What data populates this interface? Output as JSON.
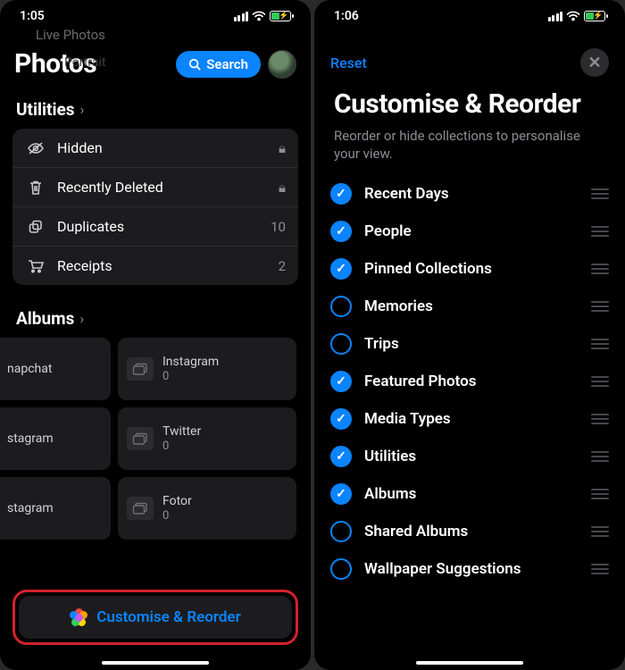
{
  "left": {
    "status": {
      "time": "1:05"
    },
    "ghost_bg_1": "Live Photos",
    "ghost_bg_2": "Portrait",
    "app_title": "Photos",
    "search_label": "Search",
    "sections": {
      "utilities": {
        "title": "Utilities",
        "rows": [
          {
            "label": "Hidden",
            "meta_icon": "lock"
          },
          {
            "label": "Recently Deleted",
            "meta_icon": "lock"
          },
          {
            "label": "Duplicates",
            "meta": "10"
          },
          {
            "label": "Receipts",
            "meta": "2"
          }
        ]
      },
      "albums": {
        "title": "Albums",
        "tiles": [
          {
            "name": "napchat",
            "partial": true
          },
          {
            "name": "Instagram",
            "count": "0"
          },
          {
            "name": "stagram",
            "partial": true
          },
          {
            "name": "Twitter",
            "count": "0"
          },
          {
            "name": "stagram",
            "partial": true
          },
          {
            "name": "Fotor",
            "count": "0"
          }
        ]
      }
    },
    "customise_label": "Customise & Reorder"
  },
  "right": {
    "status": {
      "time": "1:06"
    },
    "reset_label": "Reset",
    "sheet_title": "Customise & Reorder",
    "sheet_subtitle": "Reorder or hide collections to personalise your view.",
    "items": [
      {
        "label": "Recent Days",
        "checked": true
      },
      {
        "label": "People",
        "checked": true
      },
      {
        "label": "Pinned Collections",
        "checked": true
      },
      {
        "label": "Memories",
        "checked": false
      },
      {
        "label": "Trips",
        "checked": false
      },
      {
        "label": "Featured Photos",
        "checked": true
      },
      {
        "label": "Media Types",
        "checked": true
      },
      {
        "label": "Utilities",
        "checked": true
      },
      {
        "label": "Albums",
        "checked": true
      },
      {
        "label": "Shared Albums",
        "checked": false
      },
      {
        "label": "Wallpaper Suggestions",
        "checked": false
      }
    ]
  }
}
